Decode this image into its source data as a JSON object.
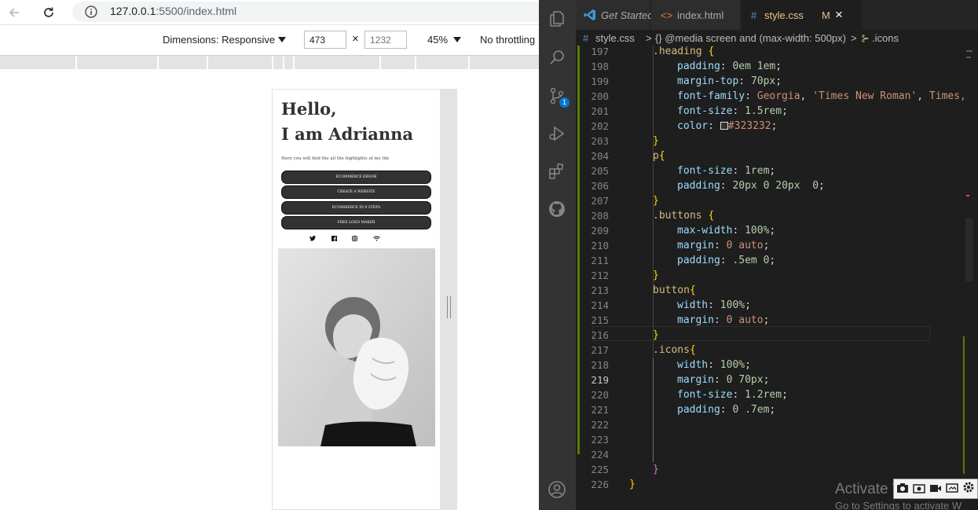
{
  "browser": {
    "url_host": "127.0.0.1",
    "url_path": ":5500/index.html",
    "toolbar": {
      "dimensions_label": "Dimensions: Responsive",
      "width_value": "473",
      "height_placeholder": "1232",
      "times_symbol": "×",
      "zoom": "45%",
      "throttling": "No throttling"
    }
  },
  "site": {
    "heading_line1": "Hello,",
    "heading_line2": "I am Adrianna",
    "intro": "Here you will find the all the highlights of my life",
    "buttons": [
      "ECOMMERCE EBOOK",
      "CREATE A WEBSITE",
      "ECOMMERCE IN 9 STEPS",
      "FREE LOGO MAKER"
    ],
    "icons": [
      "twitter-icon",
      "facebook-icon",
      "instagram-icon",
      "wifi-icon"
    ]
  },
  "editor": {
    "tabs": [
      {
        "label": "Get Started"
      },
      {
        "label": "index.html"
      },
      {
        "label": "style.css",
        "modified": "M"
      }
    ],
    "close_symbol": "×",
    "breadcrumb": {
      "hash": "#",
      "file": "style.css",
      "sep": ">",
      "media": "{} @media screen and (max-width: 500px)",
      "selector": ".icons"
    },
    "scm_badge": "1",
    "current_line": "219",
    "line_numbers": [
      "197",
      "198",
      "199",
      "200",
      "201",
      "202",
      "203",
      "204",
      "205",
      "206",
      "207",
      "208",
      "209",
      "210",
      "211",
      "212",
      "213",
      "214",
      "215",
      "216",
      "217",
      "218",
      "219",
      "220",
      "221",
      "222",
      "223",
      "224",
      "225",
      "226"
    ],
    "code": {
      "l197_sel": ".heading",
      "l197_br": "{",
      "l198_prop": "padding",
      "l198_val": "0em 1em",
      "l199_prop": "margin-top",
      "l199_val": "70px",
      "l200_prop": "font-family",
      "l200_val1": "Georgia",
      "l200_val2": "'Times New Roman'",
      "l200_val3": "Times,",
      "l201_prop": "font-size",
      "l201_val": "1.5rem",
      "l202_prop": "color",
      "l202_val": "#323232",
      "l203_br": "}",
      "l204_sel": "p",
      "l204_br": "{",
      "l205_prop": "font-size",
      "l205_val": "1rem",
      "l206_prop": "padding",
      "l206_val": "20px 0 20px  0",
      "l207_br": "}",
      "l208_sel": ".buttons",
      "l208_br": "{",
      "l209_prop": "max-width",
      "l209_val": "100%",
      "l210_prop": "margin",
      "l210_val": "0 auto",
      "l211_prop": "padding",
      "l211_val": ".5em 0",
      "l212_br": "}",
      "l213_sel": "button",
      "l213_br": "{",
      "l214_prop": "width",
      "l214_val": "100%",
      "l215_prop": "margin",
      "l215_val": "0 auto",
      "l216_br": "}",
      "l217_sel": ".icons",
      "l217_br": "{",
      "l218_prop": "width",
      "l218_val": "100%",
      "l219_prop": "margin",
      "l219_val": "0 70px",
      "l220_prop": "font-size",
      "l220_val": "1.2rem",
      "l221_prop": "padding",
      "l221_val": "0 .7em",
      "l225_br": "}",
      "l226_br": "}"
    },
    "watermark_line1": "Activate Windows",
    "watermark_line2": "Go to Settings to activate W"
  },
  "colors": {
    "color_swatch": "#323232",
    "accent_blue": "#0078d4"
  }
}
